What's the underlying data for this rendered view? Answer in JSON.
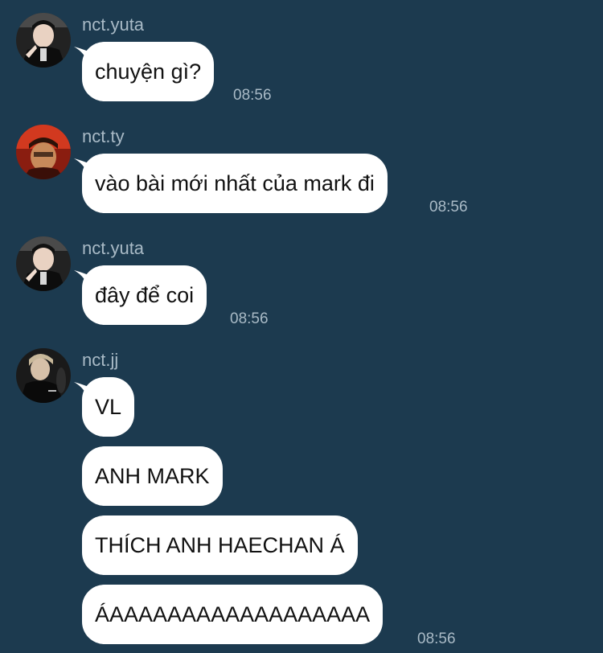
{
  "chat": {
    "colors": {
      "background": "#1c3a4f",
      "bubble": "#ffffff",
      "meta_text": "#a9bac6",
      "message_text": "#111111"
    },
    "messages": [
      {
        "sender": "nct.yuta",
        "avatar_icon": "profile-photo-icon",
        "bubbles": [
          "chuyện gì?"
        ],
        "time": "08:56"
      },
      {
        "sender": "nct.ty",
        "avatar_icon": "profile-photo-icon",
        "bubbles": [
          "vào bài mới nhất của mark đi"
        ],
        "time": "08:56"
      },
      {
        "sender": "nct.yuta",
        "avatar_icon": "profile-photo-icon",
        "bubbles": [
          "đây để coi"
        ],
        "time": "08:56"
      },
      {
        "sender": "nct.jj",
        "avatar_icon": "profile-photo-icon",
        "bubbles": [
          "VL",
          "ANH MARK",
          "THÍCH ANH HAECHAN Á",
          "ÁAAAAAAAAAAAAAAAAAA"
        ],
        "time": "08:56"
      }
    ]
  }
}
